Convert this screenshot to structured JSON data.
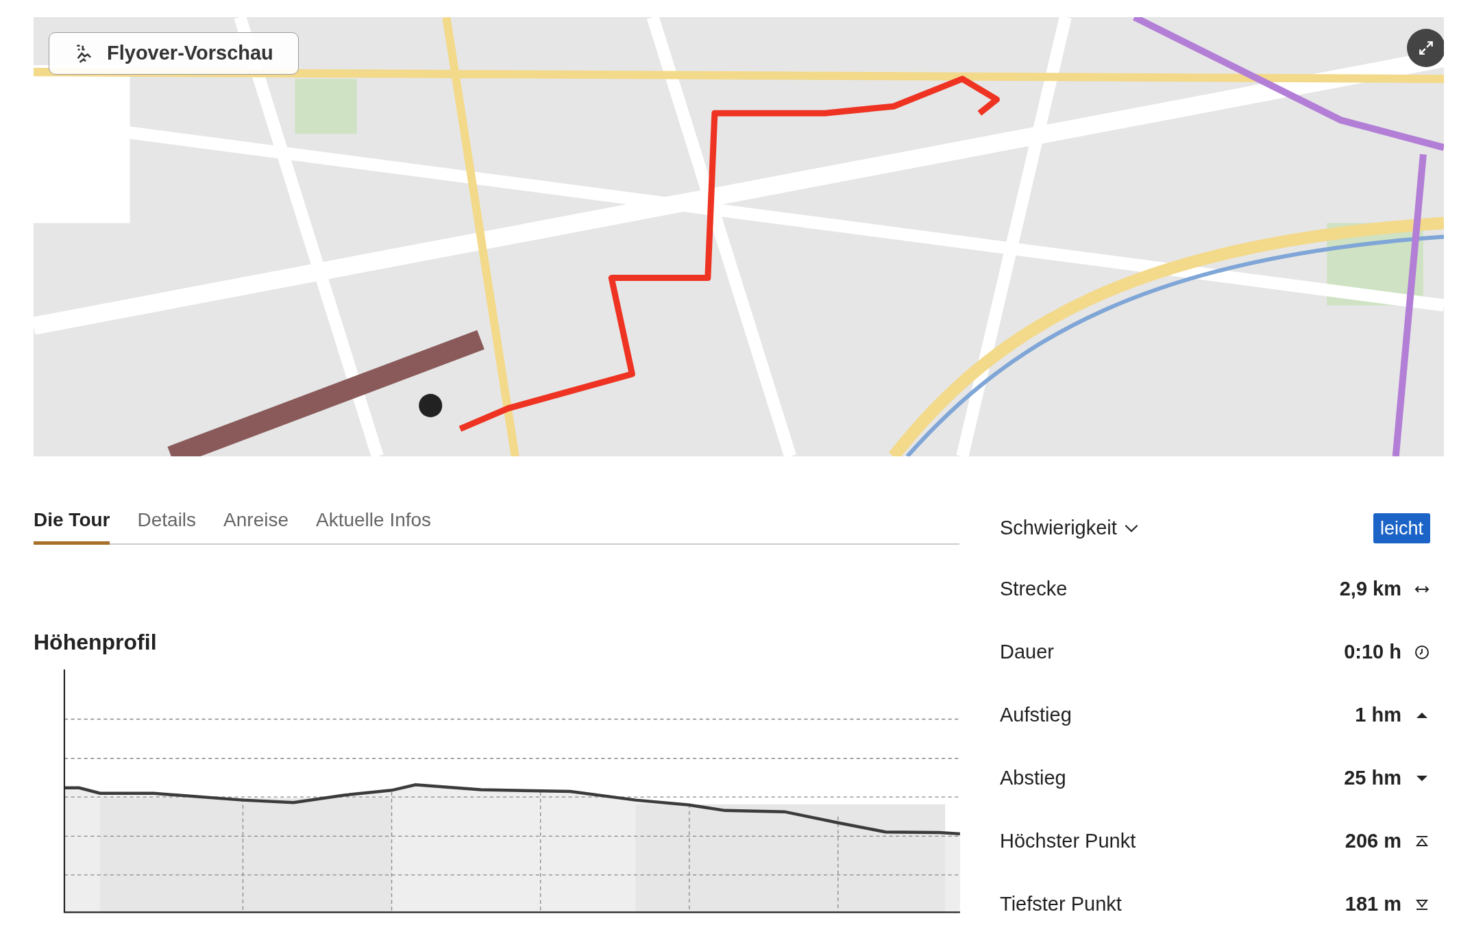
{
  "map": {
    "flyover_button": {
      "label": "Flyover-Vorschau"
    }
  },
  "tabs": [
    {
      "label": "Die Tour",
      "selected": true
    },
    {
      "label": "Details",
      "selected": false
    },
    {
      "label": "Anreise",
      "selected": false
    },
    {
      "label": "Aktuelle Infos",
      "selected": false
    }
  ],
  "elevation_profile": {
    "title": "Höhenprofil"
  },
  "difficulty": {
    "label": "Schwierigkeit",
    "value": "leicht"
  },
  "stats": [
    {
      "kind": "distance",
      "label": "Strecke",
      "value": "2,9 km"
    },
    {
      "kind": "duration",
      "label": "Dauer",
      "value": "0:10 h"
    },
    {
      "kind": "ascent",
      "label": "Aufstieg",
      "value": "1 hm"
    },
    {
      "kind": "descent",
      "label": "Abstieg",
      "value": "25 hm"
    },
    {
      "kind": "highest",
      "label": "Höchster Punkt",
      "value": "206 m"
    },
    {
      "kind": "lowest",
      "label": "Tiefster Punkt",
      "value": "181 m"
    }
  ]
}
